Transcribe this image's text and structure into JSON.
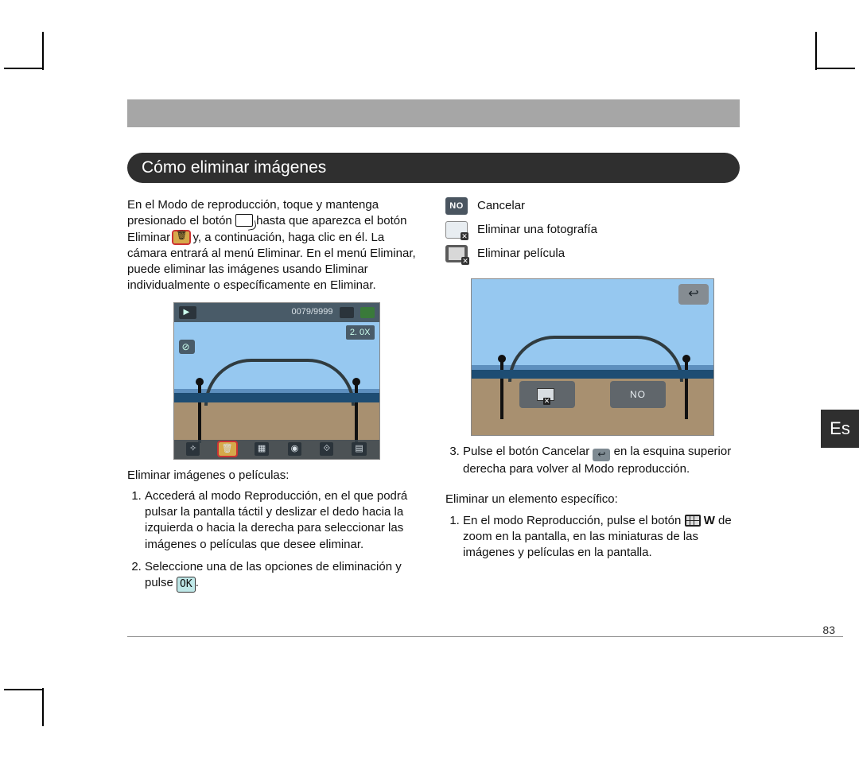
{
  "section_title": "Cómo eliminar imágenes",
  "language_tab": "Es",
  "page_number": "83",
  "left": {
    "intro_a": "En el Modo de reproducción, toque y mantenga presionado el botón ",
    "intro_b": " hasta que aparezca el botón Eliminar ",
    "intro_c": " y, a continuación, haga clic en él. La cámara entrará al menú Eliminar. En el menú Eliminar, puede eliminar las imágenes usando Eliminar individualmente o específicamente en Eliminar.",
    "lcd_top_count": "0079/9999",
    "lcd_zoom": "2. 0X",
    "subhead": "Eliminar imágenes o películas:",
    "li1": "Accederá al modo Reproducción, en el que podrá pulsar la pantalla táctil y deslizar el dedo hacia la izquierda o hacia la derecha para seleccionar las imágenes o películas que desee eliminar.",
    "li2_a": "Seleccione una de las opciones de eliminación y pulse ",
    "li2_ok": "OK",
    "li2_b": "."
  },
  "right": {
    "opt1": "Cancelar",
    "opt2": "Eliminar una fotografía",
    "opt3": "Eliminar película",
    "dlg_no": "NO",
    "li3_a": "Pulse el botón Cancelar ",
    "li3_b": " en la esquina superior derecha para volver al Modo reproducción.",
    "subhead2": "Eliminar un elemento específico:",
    "li4_a": "En el modo Reproducción, pulse el botón ",
    "li4_w": "W",
    "li4_b": " de zoom en la pantalla, en las miniaturas de las imágenes y películas en la pantalla."
  }
}
